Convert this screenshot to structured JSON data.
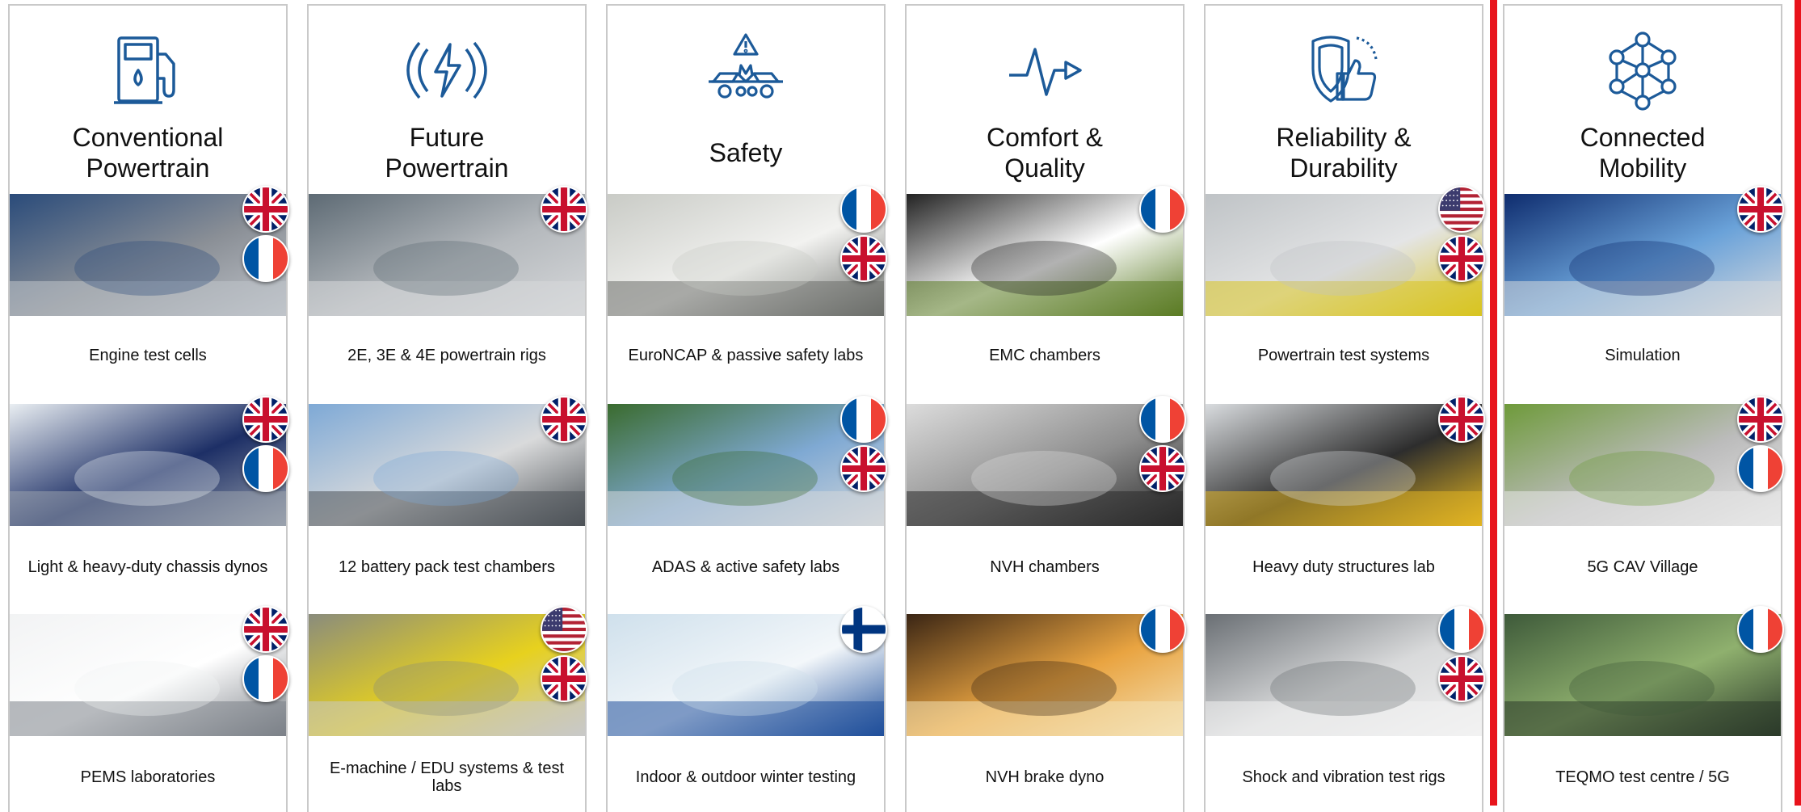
{
  "colors": {
    "icon": "#1c5a99",
    "accent_red": "#e8141c",
    "border": "#c9c9c9"
  },
  "columns": [
    {
      "title": "Conventional\nPowertrain",
      "icon": "fuel-pump-icon",
      "items": [
        {
          "caption": "Engine test cells",
          "flags": [
            "uk",
            "fr"
          ]
        },
        {
          "caption": "Light & heavy-duty chassis dynos",
          "flags": [
            "uk",
            "fr"
          ]
        },
        {
          "caption": "PEMS laboratories",
          "flags": [
            "uk",
            "fr"
          ]
        }
      ]
    },
    {
      "title": "Future\nPowertrain",
      "icon": "electric-bolt-icon",
      "items": [
        {
          "caption": "2E, 3E & 4E powertrain rigs",
          "flags": [
            "uk"
          ]
        },
        {
          "caption": "12 battery pack test chambers",
          "flags": [
            "uk"
          ]
        },
        {
          "caption": "E-machine / EDU systems & test labs",
          "flags": [
            "us",
            "uk"
          ]
        }
      ]
    },
    {
      "title": "Safety",
      "icon": "car-crash-icon",
      "items": [
        {
          "caption": "EuroNCAP & passive safety labs",
          "flags": [
            "fr",
            "uk"
          ]
        },
        {
          "caption": "ADAS & active safety labs",
          "flags": [
            "fr",
            "uk"
          ]
        },
        {
          "caption": "Indoor & outdoor winter testing",
          "flags": [
            "fi"
          ]
        }
      ]
    },
    {
      "title": "Comfort &\nQuality",
      "icon": "waveform-icon",
      "items": [
        {
          "caption": "EMC chambers",
          "flags": [
            "fr"
          ]
        },
        {
          "caption": "NVH chambers",
          "flags": [
            "fr",
            "uk"
          ]
        },
        {
          "caption": "NVH brake dyno",
          "flags": [
            "fr"
          ]
        }
      ]
    },
    {
      "title": "Reliability &\nDurability",
      "icon": "shield-thumbs-up-icon",
      "items": [
        {
          "caption": "Powertrain test systems",
          "flags": [
            "us",
            "uk"
          ]
        },
        {
          "caption": "Heavy duty structures lab",
          "flags": [
            "uk"
          ]
        },
        {
          "caption": "Shock and vibration test rigs",
          "flags": [
            "fr",
            "uk"
          ]
        }
      ]
    },
    {
      "title": "Connected\nMobility",
      "icon": "network-nodes-icon",
      "items": [
        {
          "caption": "Simulation",
          "flags": [
            "uk"
          ]
        },
        {
          "caption": "5G CAV Village",
          "flags": [
            "uk",
            "fr"
          ]
        },
        {
          "caption": "TEQMO test centre / 5G",
          "flags": [
            "fr"
          ]
        }
      ]
    }
  ]
}
